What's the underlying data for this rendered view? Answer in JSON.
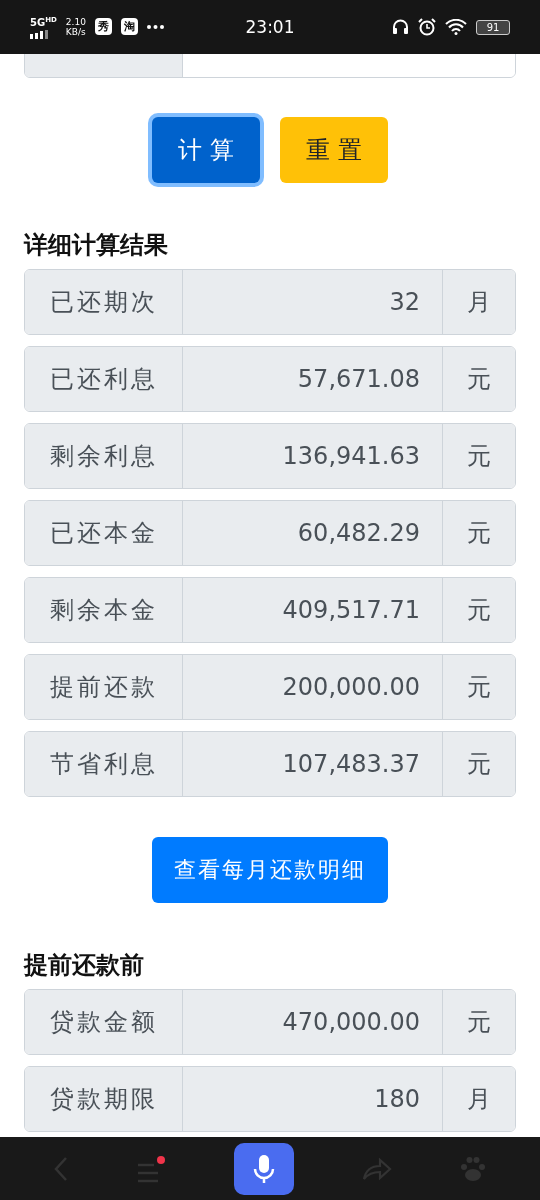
{
  "status_bar": {
    "network": "5G",
    "network_badge": "HD",
    "speed": "2.10",
    "speed_unit": "KB/s",
    "app_badges": [
      "秀",
      "淘"
    ],
    "time": "23:01",
    "battery": "91"
  },
  "actions": [
    {
      "label": "计算",
      "kind": "primary",
      "focused": true
    },
    {
      "label": "重置",
      "kind": "warning",
      "focused": false
    }
  ],
  "details": {
    "heading": "详细计算结果",
    "rows": [
      {
        "label": "已还期次",
        "value": "32",
        "unit": "月"
      },
      {
        "label": "已还利息",
        "value": "57,671.08",
        "unit": "元"
      },
      {
        "label": "剩余利息",
        "value": "136,941.63",
        "unit": "元"
      },
      {
        "label": "已还本金",
        "value": "60,482.29",
        "unit": "元"
      },
      {
        "label": "剩余本金",
        "value": "409,517.71",
        "unit": "元"
      },
      {
        "label": "提前还款",
        "value": "200,000.00",
        "unit": "元"
      },
      {
        "label": "节省利息",
        "value": "107,483.37",
        "unit": "元"
      }
    ]
  },
  "monthly_button": "查看每月还款明细",
  "before": {
    "heading": "提前还款前",
    "rows": [
      {
        "label": "贷款金额",
        "value": "470,000.00",
        "unit": "元"
      },
      {
        "label": "贷款期限",
        "value": "180",
        "unit": "月"
      }
    ]
  },
  "bottom_nav": {
    "menu_notification": true
  }
}
